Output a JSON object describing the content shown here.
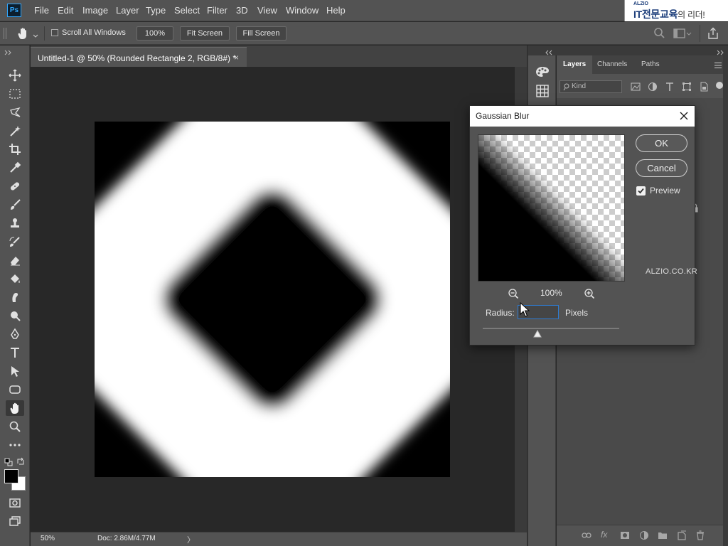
{
  "app": {
    "logo_text": "Ps"
  },
  "menu": {
    "items": [
      "File",
      "Edit",
      "Image",
      "Layer",
      "Type",
      "Select",
      "Filter",
      "3D",
      "View",
      "Window",
      "Help"
    ]
  },
  "brand": {
    "small": "ALZIO",
    "main": "IT전문교육",
    "tail": "의 리더!"
  },
  "options": {
    "scroll_all_label": "Scroll All Windows",
    "zoom_value": "100%",
    "fit_screen_label": "Fit Screen",
    "fill_screen_label": "Fill Screen"
  },
  "document": {
    "tab_title": "Untitled-1 @ 50% (Rounded Rectangle 2, RGB/8#) *",
    "tab_close": "×",
    "zoom_status": "50%",
    "doc_status": "Doc: 2.86M/4.77M",
    "status_arrow": "〉"
  },
  "panels": {
    "tabs": [
      "Layers",
      "Channels",
      "Paths"
    ],
    "active_tab": "Layers",
    "kind_filter": "Kind"
  },
  "dialog": {
    "title": "Gaussian Blur",
    "ok_label": "OK",
    "cancel_label": "Cancel",
    "preview_label": "Preview",
    "preview_checked": true,
    "zoom_level": "100%",
    "radius_label": "Radius:",
    "radius_value": "",
    "units_label": "Pixels"
  },
  "watermark": "ALZIO.CO.KR",
  "colors": {
    "accent": "#31a8ff",
    "panel_bg": "#535353",
    "canvas_bg": "#282828",
    "focus_border": "#2e7bd0"
  }
}
